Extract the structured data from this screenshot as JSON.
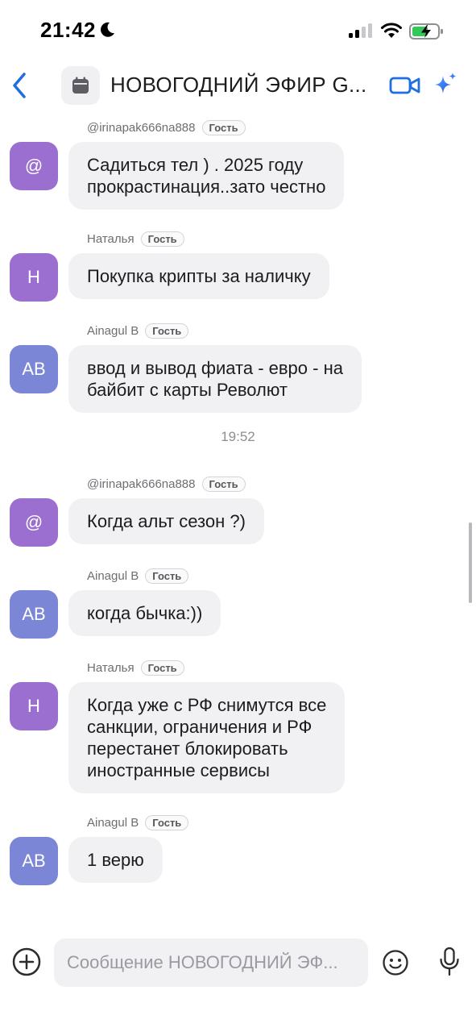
{
  "status_bar": {
    "time": "21:42",
    "battery_color": "#34c759"
  },
  "header": {
    "title": "НОВОГОДНИЙ ЭФИР G...",
    "accent": "#1f6fe0"
  },
  "thread": {
    "messages": [
      {
        "kind": "message",
        "sender": "@irinapak666na888",
        "badge": "Гость",
        "avatar_text": "@",
        "avatar_color": "#9b6fd0",
        "text": "Садиться тел ) . 2025 году\nпрокрастинация..зато честно"
      },
      {
        "kind": "message",
        "sender": "Наталья",
        "badge": "Гость",
        "avatar_text": "Н",
        "avatar_color": "#9b6fd0",
        "text": "Покупка крипты за наличку"
      },
      {
        "kind": "message",
        "sender": "Ainagul B",
        "badge": "Гость",
        "avatar_text": "AB",
        "avatar_color": "#7b86d6",
        "text": "ввод и вывод фиата - евро - на\nбайбит с карты Револют"
      },
      {
        "kind": "divider",
        "text": "19:52"
      },
      {
        "kind": "message",
        "sender": "@irinapak666na888",
        "badge": "Гость",
        "avatar_text": "@",
        "avatar_color": "#9b6fd0",
        "text": "Когда альт сезон ?)"
      },
      {
        "kind": "message",
        "sender": "Ainagul B",
        "badge": "Гость",
        "avatar_text": "AB",
        "avatar_color": "#7b86d6",
        "text": "когда бычка:))"
      },
      {
        "kind": "message",
        "sender": "Наталья",
        "badge": "Гость",
        "avatar_text": "Н",
        "avatar_color": "#9b6fd0",
        "text": "Когда уже с РФ снимутся все\nсанкции, ограничения и РФ\nперестанет блокировать\nиностранные сервисы"
      },
      {
        "kind": "message",
        "sender": "Ainagul B",
        "badge": "Гость",
        "avatar_text": "AB",
        "avatar_color": "#7b86d6",
        "text": "1 верю"
      }
    ]
  },
  "composer": {
    "placeholder": "Сообщение НОВОГОДНИЙ ЭФ..."
  }
}
